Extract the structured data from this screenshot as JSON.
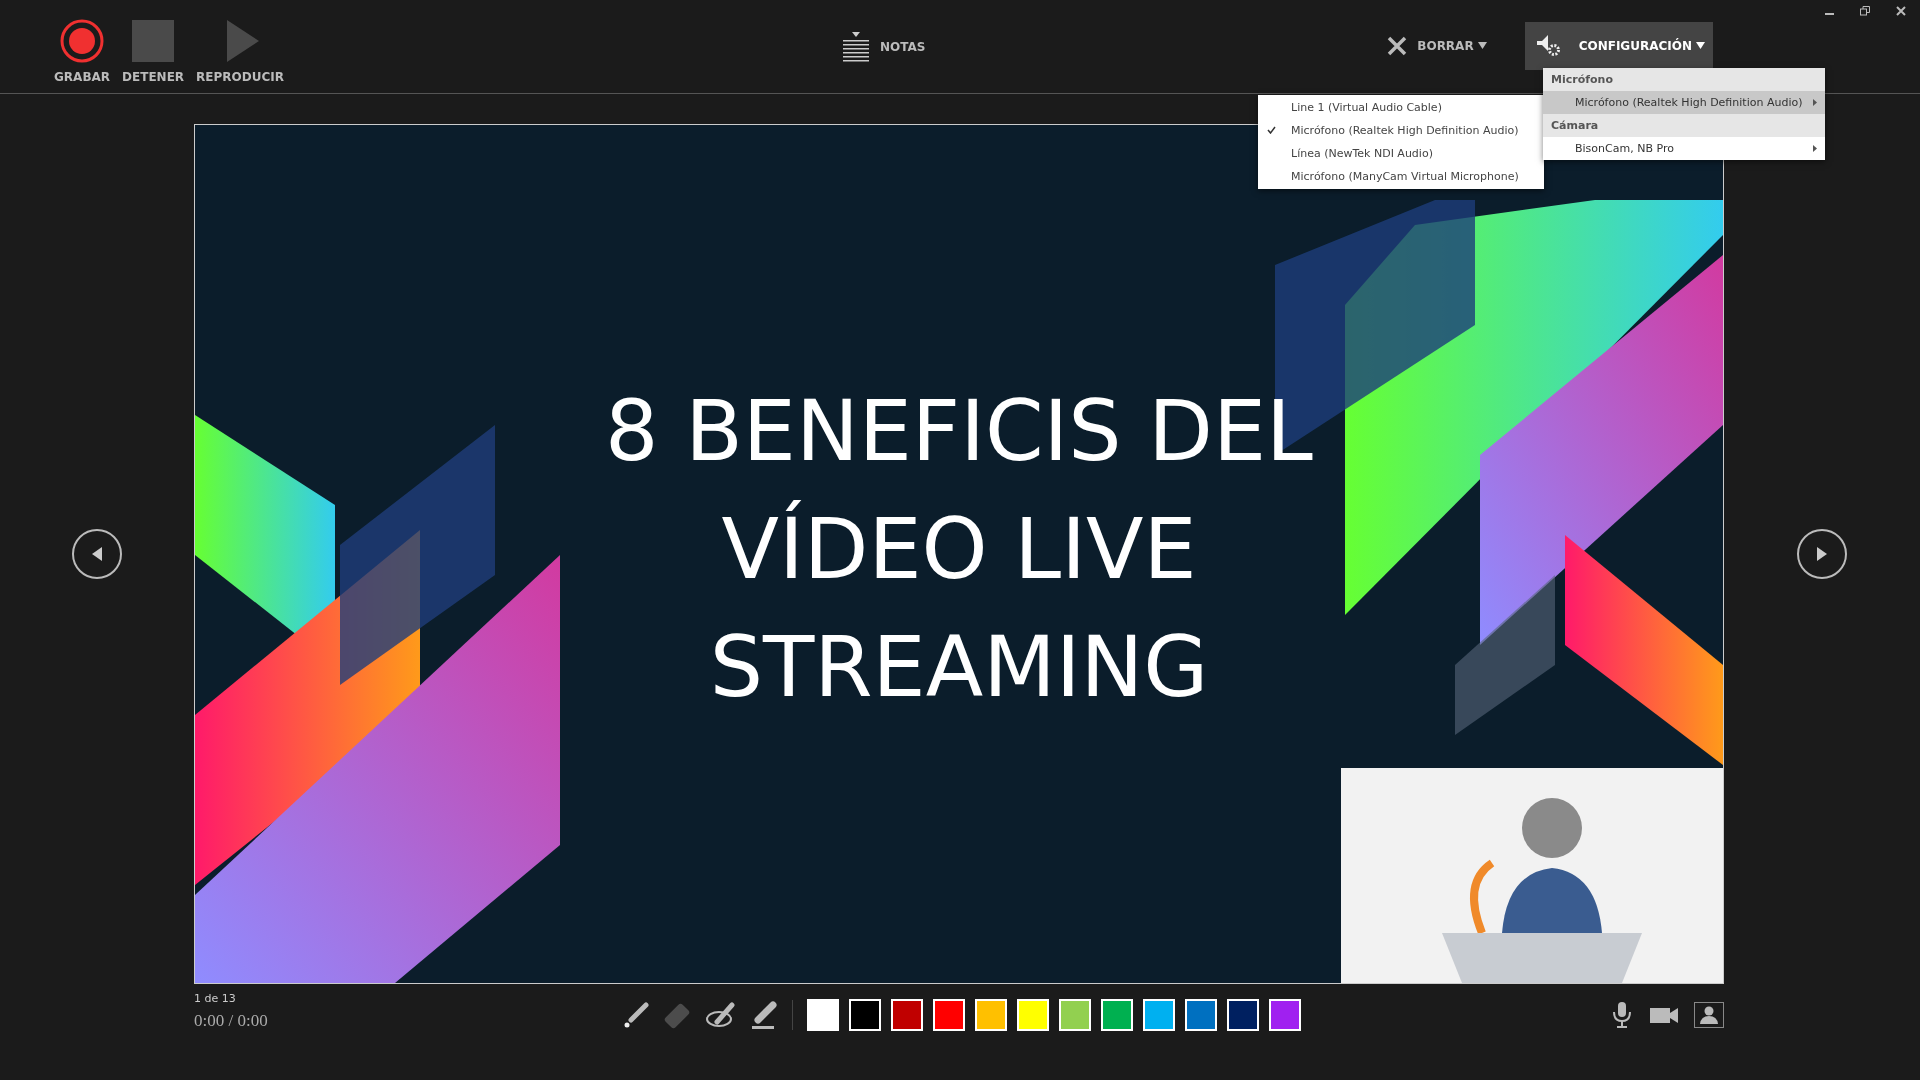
{
  "toolbar": {
    "record_controls": [
      {
        "kind": "record",
        "label": "GRABAR"
      },
      {
        "kind": "stop",
        "label": "DETENER"
      },
      {
        "kind": "play",
        "label": "REPRODUCIR"
      }
    ],
    "notes": {
      "label": "NOTAS"
    },
    "clear": {
      "label": "BORRAR"
    },
    "settings": {
      "label": "CONFIGURACIÓN",
      "expanded": true
    }
  },
  "settings_menu": {
    "sections": [
      {
        "heading": "Micrófono",
        "items": [
          {
            "label": "Micrófono (Realtek High Definition Audio)",
            "selected": true
          }
        ]
      },
      {
        "heading": "Cámara",
        "items": [
          {
            "label": "BisonCam, NB Pro",
            "selected": false
          }
        ]
      }
    ]
  },
  "microphone_submenu": {
    "items": [
      {
        "label": "Line 1 (Virtual Audio Cable)",
        "checked": false
      },
      {
        "label": "Micrófono (Realtek High Definition Audio)",
        "checked": true
      },
      {
        "label": "Línea (NewTek NDI Audio)",
        "checked": false
      },
      {
        "label": "Micrófono (ManyCam Virtual Microphone)",
        "checked": false
      }
    ]
  },
  "slide": {
    "title_lines": [
      "8 BENEFICIS DEL",
      "VÍDEO LIVE",
      "STREAMING"
    ]
  },
  "footer": {
    "slide_counter": "1 de 13",
    "time": "0:00 / 0:00",
    "tools": [
      {
        "kind": "laser",
        "disabled": false
      },
      {
        "kind": "eraser",
        "disabled": true
      },
      {
        "kind": "pen",
        "disabled": false
      },
      {
        "kind": "highlighter",
        "disabled": false
      }
    ],
    "colors": [
      {
        "color": "#ffffff"
      },
      {
        "color": "#000000"
      },
      {
        "color": "#c00000"
      },
      {
        "color": "#ff0000"
      },
      {
        "color": "#ffc000"
      },
      {
        "color": "#ffff00"
      },
      {
        "color": "#92d050"
      },
      {
        "color": "#00b050"
      },
      {
        "color": "#00b0f0"
      },
      {
        "color": "#0070c0"
      },
      {
        "color": "#002060"
      },
      {
        "color": "#a020f0"
      }
    ]
  }
}
